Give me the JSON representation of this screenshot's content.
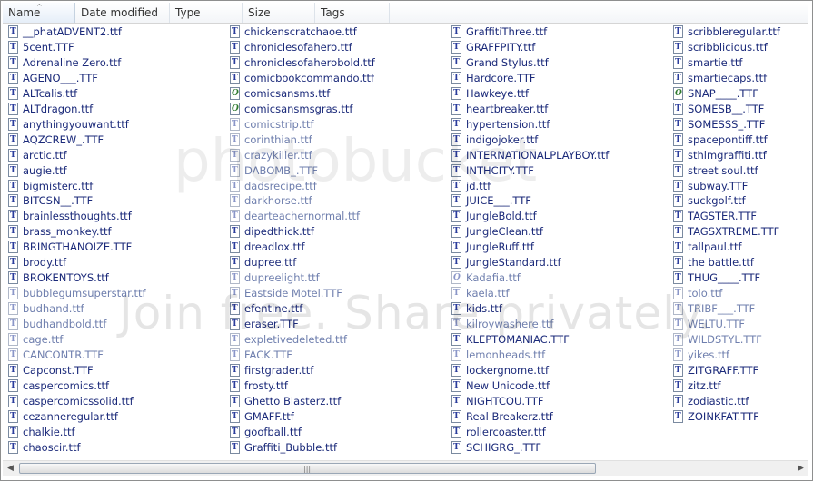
{
  "header": {
    "columns": [
      "Name",
      "Date modified",
      "Type",
      "Size",
      "Tags"
    ],
    "sort_indicator": "^"
  },
  "watermark": {
    "logo_text": "photobucket",
    "text": "Join free. Share privately."
  },
  "scrollbar": {
    "left_arrow": "◀",
    "right_arrow": "▶",
    "grip": "|||"
  },
  "files": [
    [
      {
        "name": "__phatADVENT2.ttf",
        "icon": "tt",
        "faded": false
      },
      {
        "name": "5cent.TTF",
        "icon": "tt",
        "faded": false
      },
      {
        "name": "Adrenaline Zero.ttf",
        "icon": "tt",
        "faded": false
      },
      {
        "name": "AGENO___.TTF",
        "icon": "tt",
        "faded": false
      },
      {
        "name": "ALTcalis.ttf",
        "icon": "tt",
        "faded": false
      },
      {
        "name": "ALTdragon.ttf",
        "icon": "tt",
        "faded": false
      },
      {
        "name": "anythingyouwant.ttf",
        "icon": "tt",
        "faded": false
      },
      {
        "name": "AQZCREW_.TTF",
        "icon": "tt",
        "faded": false
      },
      {
        "name": "arctic.ttf",
        "icon": "tt",
        "faded": false
      },
      {
        "name": "augie.ttf",
        "icon": "tt",
        "faded": false
      },
      {
        "name": "bigmisterc.ttf",
        "icon": "tt",
        "faded": false
      },
      {
        "name": "BITCSN__.TTF",
        "icon": "tt",
        "faded": false
      },
      {
        "name": "brainlessthoughts.ttf",
        "icon": "tt",
        "faded": false
      },
      {
        "name": "brass_monkey.ttf",
        "icon": "tt",
        "faded": false
      },
      {
        "name": "BRINGTHANOIZE.TTF",
        "icon": "tt",
        "faded": false
      },
      {
        "name": "brody.ttf",
        "icon": "tt",
        "faded": false
      },
      {
        "name": "BROKENTOYS.ttf",
        "icon": "tt",
        "faded": false
      },
      {
        "name": "bubblegumsuperstar.ttf",
        "icon": "tt",
        "faded": true
      },
      {
        "name": "budhand.ttf",
        "icon": "tt",
        "faded": true
      },
      {
        "name": "budhandbold.ttf",
        "icon": "tt",
        "faded": true
      },
      {
        "name": "cage.ttf",
        "icon": "tt",
        "faded": true
      },
      {
        "name": "CANCONTR.TTF",
        "icon": "tt",
        "faded": true
      },
      {
        "name": "Capconst.TTF",
        "icon": "tt",
        "faded": false
      },
      {
        "name": "caspercomics.ttf",
        "icon": "tt",
        "faded": false
      },
      {
        "name": "caspercomicssolid.ttf",
        "icon": "tt",
        "faded": false
      },
      {
        "name": "cezanneregular.ttf",
        "icon": "tt",
        "faded": false
      },
      {
        "name": "chalkie.ttf",
        "icon": "tt",
        "faded": false
      },
      {
        "name": "chaoscir.ttf",
        "icon": "tt",
        "faded": false
      }
    ],
    [
      {
        "name": "chickenscratchaoe.ttf",
        "icon": "tt",
        "faded": false
      },
      {
        "name": "chroniclesofahero.ttf",
        "icon": "tt",
        "faded": false
      },
      {
        "name": "chroniclesofaherobold.ttf",
        "icon": "tt",
        "faded": false
      },
      {
        "name": "comicbookcommando.ttf",
        "icon": "tt",
        "faded": false
      },
      {
        "name": "comicsansms.ttf",
        "icon": "o",
        "faded": false
      },
      {
        "name": "comicsansmsgras.ttf",
        "icon": "o",
        "faded": false
      },
      {
        "name": "comicstrip.ttf",
        "icon": "tt",
        "faded": true
      },
      {
        "name": "corinthian.ttf",
        "icon": "tt",
        "faded": true
      },
      {
        "name": "crazykiller.ttf",
        "icon": "tt",
        "faded": true
      },
      {
        "name": "DABOMB_.TTF",
        "icon": "tt",
        "faded": true
      },
      {
        "name": "dadsrecipe.ttf",
        "icon": "tt",
        "faded": true
      },
      {
        "name": "darkhorse.ttf",
        "icon": "tt",
        "faded": true
      },
      {
        "name": "dearteachernormal.ttf",
        "icon": "tt",
        "faded": true
      },
      {
        "name": "dipedthick.ttf",
        "icon": "tt",
        "faded": false
      },
      {
        "name": "dreadlox.ttf",
        "icon": "tt",
        "faded": false
      },
      {
        "name": "dupree.ttf",
        "icon": "tt",
        "faded": false
      },
      {
        "name": "dupreelight.ttf",
        "icon": "tt",
        "faded": true
      },
      {
        "name": "Eastside Motel.TTF",
        "icon": "tt",
        "faded": true
      },
      {
        "name": "efentine.ttf",
        "icon": "tt",
        "faded": false
      },
      {
        "name": "eraser.TTF",
        "icon": "tt",
        "faded": false
      },
      {
        "name": "expletivedeleted.ttf",
        "icon": "tt",
        "faded": true
      },
      {
        "name": "FACK.TTF",
        "icon": "tt",
        "faded": true
      },
      {
        "name": "firstgrader.ttf",
        "icon": "tt",
        "faded": false
      },
      {
        "name": "frosty.ttf",
        "icon": "tt",
        "faded": false
      },
      {
        "name": "Ghetto Blasterz.ttf",
        "icon": "tt",
        "faded": false
      },
      {
        "name": "GMAFF.ttf",
        "icon": "tt",
        "faded": false
      },
      {
        "name": "goofball.ttf",
        "icon": "tt",
        "faded": false
      },
      {
        "name": "Graffiti_Bubble.ttf",
        "icon": "tt",
        "faded": false
      }
    ],
    [
      {
        "name": "GraffitiThree.ttf",
        "icon": "tt",
        "faded": false
      },
      {
        "name": "GRAFFPITY.ttf",
        "icon": "tt",
        "faded": false
      },
      {
        "name": "Grand Stylus.ttf",
        "icon": "tt",
        "faded": false
      },
      {
        "name": "Hardcore.TTF",
        "icon": "tt",
        "faded": false
      },
      {
        "name": "Hawkeye.ttf",
        "icon": "tt",
        "faded": false
      },
      {
        "name": "heartbreaker.ttf",
        "icon": "tt",
        "faded": false
      },
      {
        "name": "hypertension.ttf",
        "icon": "tt",
        "faded": false
      },
      {
        "name": "indigojoker.ttf",
        "icon": "tt",
        "faded": false
      },
      {
        "name": "INTERNATIONALPLAYBOY.ttf",
        "icon": "tt",
        "faded": false
      },
      {
        "name": "INTHCITY.TTF",
        "icon": "tt",
        "faded": false
      },
      {
        "name": "jd.ttf",
        "icon": "tt",
        "faded": false
      },
      {
        "name": "JUICE___.TTF",
        "icon": "tt",
        "faded": false
      },
      {
        "name": "JungleBold.ttf",
        "icon": "tt",
        "faded": false
      },
      {
        "name": "JungleClean.ttf",
        "icon": "tt",
        "faded": false
      },
      {
        "name": "JungleRuff.ttf",
        "icon": "tt",
        "faded": false
      },
      {
        "name": "JungleStandard.ttf",
        "icon": "tt",
        "faded": false
      },
      {
        "name": "Kadafia.ttf",
        "icon": "o",
        "faded": true
      },
      {
        "name": "kaela.ttf",
        "icon": "tt",
        "faded": true
      },
      {
        "name": "kids.ttf",
        "icon": "tt",
        "faded": false
      },
      {
        "name": "kilroywashere.ttf",
        "icon": "tt",
        "faded": true
      },
      {
        "name": "KLEPTOMANIAC.TTF",
        "icon": "tt",
        "faded": false
      },
      {
        "name": "lemonheads.ttf",
        "icon": "tt",
        "faded": true
      },
      {
        "name": "lockergnome.ttf",
        "icon": "tt",
        "faded": false
      },
      {
        "name": "New Unicode.ttf",
        "icon": "tt",
        "faded": false
      },
      {
        "name": "NIGHTCOU.TTF",
        "icon": "tt",
        "faded": false
      },
      {
        "name": "Real Breakerz.ttf",
        "icon": "tt",
        "faded": false
      },
      {
        "name": "rollercoaster.ttf",
        "icon": "tt",
        "faded": false
      },
      {
        "name": "SCHIGRG_.TTF",
        "icon": "tt",
        "faded": false
      }
    ],
    [
      {
        "name": "scribbleregular.ttf",
        "icon": "tt",
        "faded": false
      },
      {
        "name": "scribblicious.ttf",
        "icon": "tt",
        "faded": false
      },
      {
        "name": "smartie.ttf",
        "icon": "tt",
        "faded": false
      },
      {
        "name": "smartiecaps.ttf",
        "icon": "tt",
        "faded": false
      },
      {
        "name": "SNAP____.TTF",
        "icon": "o",
        "faded": false
      },
      {
        "name": "SOMESB__.TTF",
        "icon": "tt",
        "faded": false
      },
      {
        "name": "SOMESSS_.TTF",
        "icon": "tt",
        "faded": false
      },
      {
        "name": "spacepontiff.ttf",
        "icon": "tt",
        "faded": false
      },
      {
        "name": "sthlmgraffiti.ttf",
        "icon": "tt",
        "faded": false
      },
      {
        "name": "street soul.ttf",
        "icon": "tt",
        "faded": false
      },
      {
        "name": "subway.TTF",
        "icon": "tt",
        "faded": false
      },
      {
        "name": "suckgolf.ttf",
        "icon": "tt",
        "faded": false
      },
      {
        "name": "TAGSTER.TTF",
        "icon": "tt",
        "faded": false
      },
      {
        "name": "TAGSXTREME.TTF",
        "icon": "tt",
        "faded": false
      },
      {
        "name": "tallpaul.ttf",
        "icon": "tt",
        "faded": false
      },
      {
        "name": "the battle.ttf",
        "icon": "tt",
        "faded": false
      },
      {
        "name": "THUG____.TTF",
        "icon": "tt",
        "faded": false
      },
      {
        "name": "tolo.ttf",
        "icon": "tt",
        "faded": true
      },
      {
        "name": "TRIBF___.TTF",
        "icon": "tt",
        "faded": true
      },
      {
        "name": "WELTU.TTF",
        "icon": "tt",
        "faded": true
      },
      {
        "name": "WILDSTYL.TTF",
        "icon": "tt",
        "faded": true
      },
      {
        "name": "yikes.ttf",
        "icon": "tt",
        "faded": true
      },
      {
        "name": "ZITGRAFF.TTF",
        "icon": "tt",
        "faded": false
      },
      {
        "name": "zitz.ttf",
        "icon": "tt",
        "faded": false
      },
      {
        "name": "zodiastic.ttf",
        "icon": "tt",
        "faded": false
      },
      {
        "name": "ZOINKFAT.TTF",
        "icon": "tt",
        "faded": false
      }
    ]
  ]
}
